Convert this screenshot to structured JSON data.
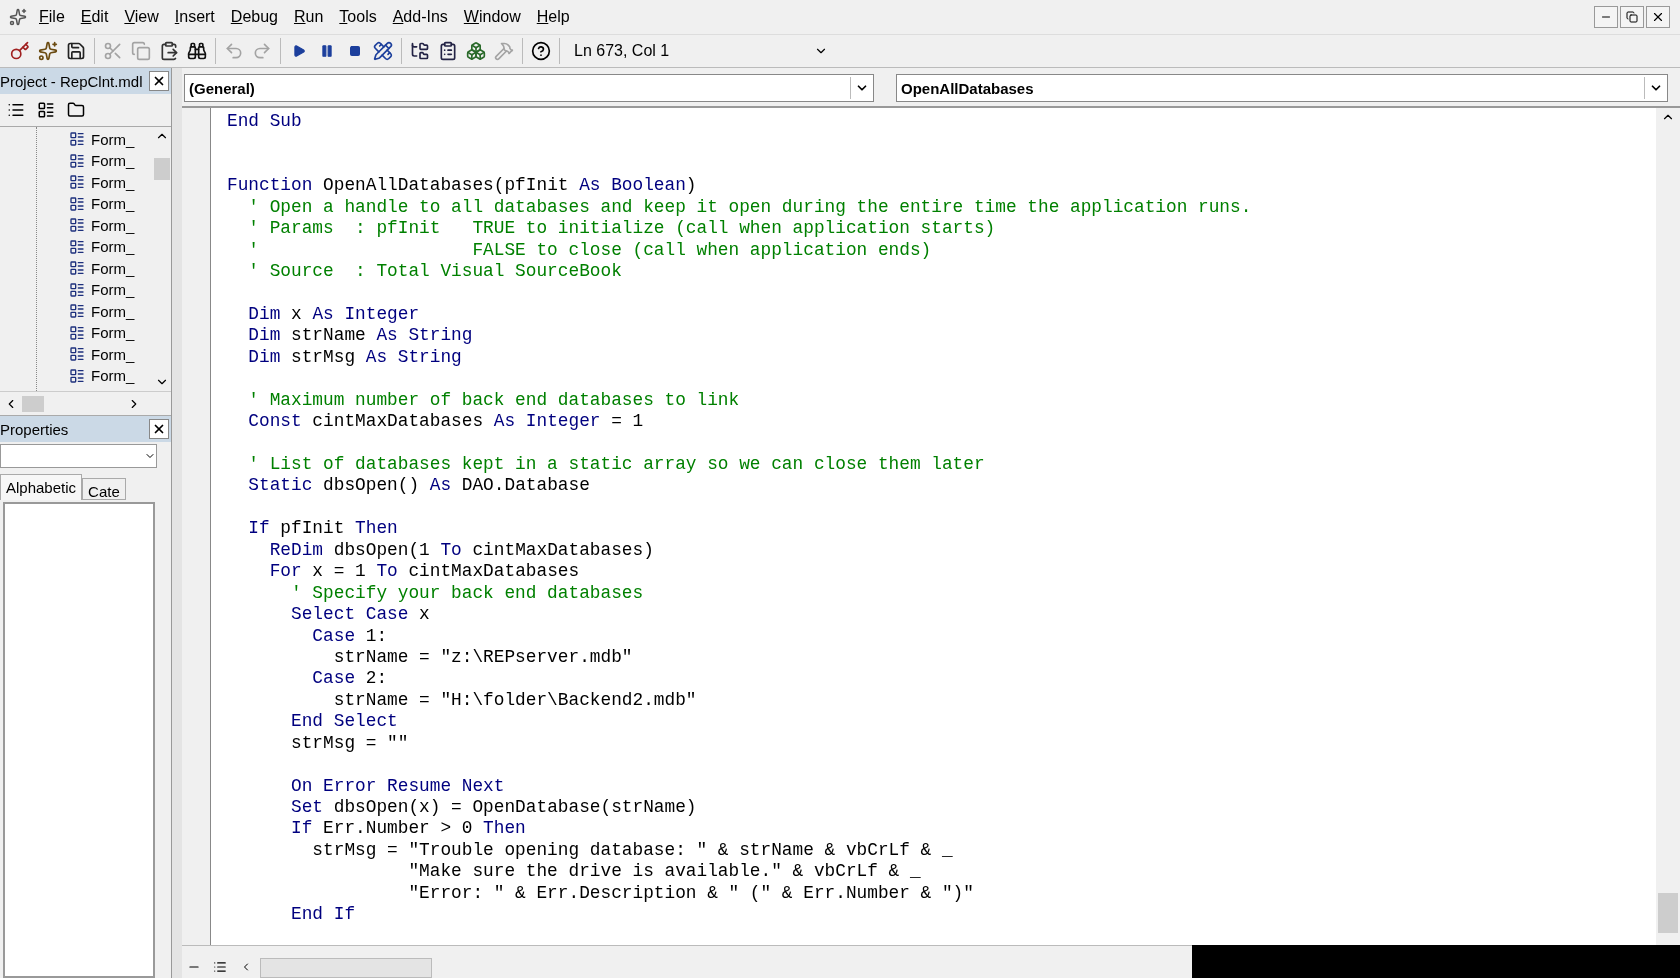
{
  "menu": [
    {
      "label": "File"
    },
    {
      "label": "Edit"
    },
    {
      "label": "View"
    },
    {
      "label": "Insert"
    },
    {
      "label": "Debug"
    },
    {
      "label": "Run"
    },
    {
      "label": "Tools"
    },
    {
      "label": "Add-Ins"
    },
    {
      "label": "Window"
    },
    {
      "label": "Help"
    }
  ],
  "toolbar": {
    "buttons": [
      {
        "kind": "access",
        "disabled": false
      },
      {
        "kind": "insert",
        "disabled": false
      },
      {
        "kind": "save",
        "disabled": false
      },
      {
        "kind": "cut",
        "disabled": true
      },
      {
        "kind": "copy",
        "disabled": true
      },
      {
        "kind": "paste",
        "disabled": false
      },
      {
        "kind": "find",
        "disabled": false
      },
      {
        "kind": "undo",
        "disabled": true
      },
      {
        "kind": "redo",
        "disabled": true
      },
      {
        "kind": "run",
        "disabled": false
      },
      {
        "kind": "pause",
        "disabled": false
      },
      {
        "kind": "stop",
        "disabled": false
      },
      {
        "kind": "design",
        "disabled": false
      },
      {
        "kind": "explorer",
        "disabled": false
      },
      {
        "kind": "properties",
        "disabled": false
      },
      {
        "kind": "browser",
        "disabled": false
      },
      {
        "kind": "toolbox",
        "disabled": true
      },
      {
        "kind": "help",
        "disabled": false
      }
    ],
    "position": "Ln 673, Col 1"
  },
  "project": {
    "title": "Project - RepClnt.mdl",
    "items": [
      "Form_",
      "Form_",
      "Form_",
      "Form_",
      "Form_",
      "Form_",
      "Form_",
      "Form_",
      "Form_",
      "Form_",
      "Form_",
      "Form_"
    ]
  },
  "properties": {
    "title": "Properties",
    "tabs": [
      {
        "label": "Alphabetic",
        "selected": true
      },
      {
        "label": "Cate",
        "selected": false
      }
    ]
  },
  "editor": {
    "object": "(General)",
    "procedure": "OpenAllDatabases",
    "lines": [
      {
        "segments": [
          {
            "kind": "keyword",
            "text": "End Sub"
          }
        ]
      },
      {
        "kind": "blank"
      },
      {
        "kind": "blank"
      },
      {
        "segments": [
          {
            "kind": "keyword",
            "text": "Function"
          },
          {
            "kind": "plain",
            "text": " OpenAllDatabases(pfInit "
          },
          {
            "kind": "keyword",
            "text": "As Boolean"
          },
          {
            "kind": "plain",
            "text": ")"
          }
        ]
      },
      {
        "segments": [
          {
            "kind": "comment",
            "text": "  ' Open a handle to all databases and keep it open during the entire time the application runs."
          }
        ]
      },
      {
        "segments": [
          {
            "kind": "comment",
            "text": "  ' Params  : pfInit   TRUE to initialize (call when application starts)"
          }
        ]
      },
      {
        "segments": [
          {
            "kind": "comment",
            "text": "  '                    FALSE to close (call when application ends)"
          }
        ]
      },
      {
        "segments": [
          {
            "kind": "comment",
            "text": "  ' Source  : Total Visual SourceBook"
          }
        ]
      },
      {
        "kind": "blank"
      },
      {
        "segments": [
          {
            "kind": "keyword",
            "text": "  Dim"
          },
          {
            "kind": "plain",
            "text": " x "
          },
          {
            "kind": "keyword",
            "text": "As Integer"
          }
        ]
      },
      {
        "segments": [
          {
            "kind": "keyword",
            "text": "  Dim"
          },
          {
            "kind": "plain",
            "text": " strName "
          },
          {
            "kind": "keyword",
            "text": "As String"
          }
        ]
      },
      {
        "segments": [
          {
            "kind": "keyword",
            "text": "  Dim"
          },
          {
            "kind": "plain",
            "text": " strMsg "
          },
          {
            "kind": "keyword",
            "text": "As String"
          }
        ]
      },
      {
        "kind": "blank"
      },
      {
        "segments": [
          {
            "kind": "comment",
            "text": "  ' Maximum number of back end databases to link"
          }
        ]
      },
      {
        "segments": [
          {
            "kind": "keyword",
            "text": "  Const"
          },
          {
            "kind": "plain",
            "text": " cintMaxDatabases "
          },
          {
            "kind": "keyword",
            "text": "As Integer"
          },
          {
            "kind": "plain",
            "text": " = 1"
          }
        ]
      },
      {
        "kind": "blank"
      },
      {
        "segments": [
          {
            "kind": "comment",
            "text": "  ' List of databases kept in a static array so we can close them later"
          }
        ]
      },
      {
        "segments": [
          {
            "kind": "keyword",
            "text": "  Static"
          },
          {
            "kind": "plain",
            "text": " dbsOpen() "
          },
          {
            "kind": "keyword",
            "text": "As"
          },
          {
            "kind": "plain",
            "text": " DAO.Database"
          }
        ]
      },
      {
        "kind": "blank"
      },
      {
        "segments": [
          {
            "kind": "keyword",
            "text": "  If"
          },
          {
            "kind": "plain",
            "text": " pfInit "
          },
          {
            "kind": "keyword",
            "text": "Then"
          }
        ]
      },
      {
        "segments": [
          {
            "kind": "keyword",
            "text": "    ReDim"
          },
          {
            "kind": "plain",
            "text": " dbsOpen(1 "
          },
          {
            "kind": "keyword",
            "text": "To"
          },
          {
            "kind": "plain",
            "text": " cintMaxDatabases)"
          }
        ]
      },
      {
        "segments": [
          {
            "kind": "keyword",
            "text": "    For"
          },
          {
            "kind": "plain",
            "text": " x = 1 "
          },
          {
            "kind": "keyword",
            "text": "To"
          },
          {
            "kind": "plain",
            "text": " cintMaxDatabases"
          }
        ]
      },
      {
        "segments": [
          {
            "kind": "comment",
            "text": "      ' Specify your back end databases"
          }
        ]
      },
      {
        "segments": [
          {
            "kind": "keyword",
            "text": "      Select Case"
          },
          {
            "kind": "plain",
            "text": " x"
          }
        ]
      },
      {
        "segments": [
          {
            "kind": "keyword",
            "text": "        Case"
          },
          {
            "kind": "plain",
            "text": " 1:"
          }
        ]
      },
      {
        "segments": [
          {
            "kind": "plain",
            "text": "          strName = \"z:\\REPserver.mdb\""
          }
        ]
      },
      {
        "segments": [
          {
            "kind": "keyword",
            "text": "        Case"
          },
          {
            "kind": "plain",
            "text": " 2:"
          }
        ]
      },
      {
        "segments": [
          {
            "kind": "plain",
            "text": "          strName = \"H:\\folder\\Backend2.mdb\""
          }
        ]
      },
      {
        "segments": [
          {
            "kind": "keyword",
            "text": "      End Select"
          }
        ]
      },
      {
        "segments": [
          {
            "kind": "plain",
            "text": "      strMsg = \"\""
          }
        ]
      },
      {
        "kind": "blank"
      },
      {
        "segments": [
          {
            "kind": "keyword",
            "text": "      On Error Resume Next"
          }
        ]
      },
      {
        "segments": [
          {
            "kind": "keyword",
            "text": "      Set"
          },
          {
            "kind": "plain",
            "text": " dbsOpen(x) = OpenDatabase(strName)"
          }
        ]
      },
      {
        "segments": [
          {
            "kind": "keyword",
            "text": "      If"
          },
          {
            "kind": "plain",
            "text": " Err.Number > 0 "
          },
          {
            "kind": "keyword",
            "text": "Then"
          }
        ]
      },
      {
        "segments": [
          {
            "kind": "plain",
            "text": "        strMsg = \"Trouble opening database: \" & strName & vbCrLf & _"
          }
        ]
      },
      {
        "segments": [
          {
            "kind": "plain",
            "text": "                 \"Make sure the drive is available.\" & vbCrLf & _"
          }
        ]
      },
      {
        "segments": [
          {
            "kind": "plain",
            "text": "                 \"Error: \" & Err.Description & \" (\" & Err.Number & \")\""
          }
        ]
      },
      {
        "segments": [
          {
            "kind": "keyword",
            "text": "      End If"
          }
        ]
      }
    ]
  }
}
